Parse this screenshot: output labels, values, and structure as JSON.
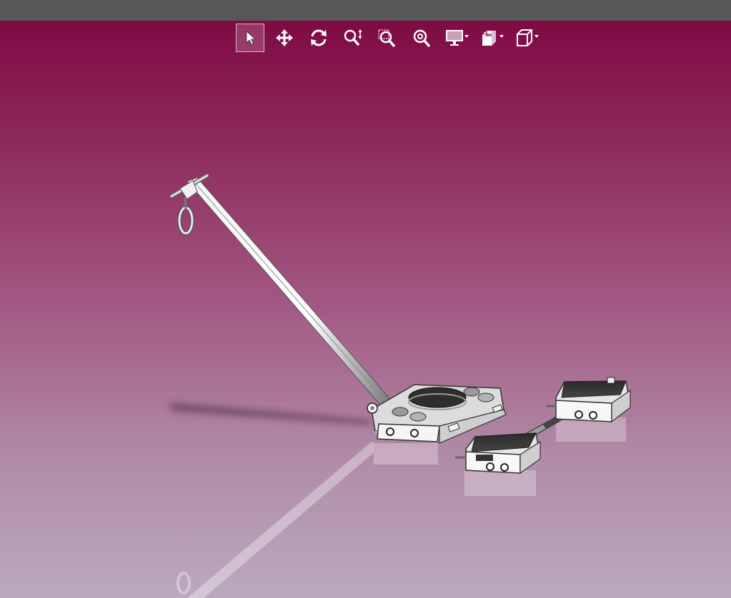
{
  "window": {
    "accent_top": "#7f0a44",
    "accent_bottom": "#bba9bf",
    "titlebar_color": "#575757"
  },
  "toolbar": {
    "tools": [
      {
        "id": "select",
        "icon": "cursor-arrow-icon",
        "active": true
      },
      {
        "id": "pan",
        "icon": "move-arrows-icon",
        "active": false
      },
      {
        "id": "rotate",
        "icon": "rotate-icon",
        "active": false
      },
      {
        "id": "zoom",
        "icon": "zoom-icon",
        "active": false
      },
      {
        "id": "zoom-window",
        "icon": "zoom-window-icon",
        "active": false
      },
      {
        "id": "zoom-fit",
        "icon": "zoom-fit-icon",
        "active": false
      },
      {
        "id": "display-mode",
        "icon": "monitor-icon",
        "dropdown": true
      },
      {
        "id": "section",
        "icon": "section-cube-icon",
        "dropdown": true
      },
      {
        "id": "view-orientation",
        "icon": "cube-view-icon",
        "dropdown": true
      }
    ]
  },
  "model": {
    "description_icon": "machinery-skate-model-icon"
  }
}
